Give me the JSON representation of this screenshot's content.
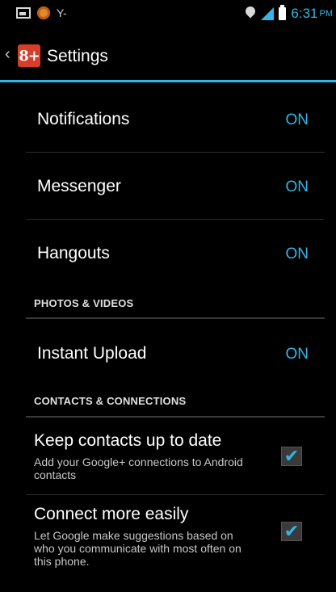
{
  "status_bar": {
    "notification_text": "Y-",
    "time": "6:31",
    "ampm": "PM",
    "accent": "#33b5e5",
    "icons": [
      "image-notification-icon",
      "coin-notification-icon",
      "location-icon",
      "signal-icon",
      "battery-icon"
    ]
  },
  "action_bar": {
    "logo_text": "8+",
    "title": "Settings"
  },
  "settings": {
    "notifications": {
      "label": "Notifications",
      "value": "ON"
    },
    "messenger": {
      "label": "Messenger",
      "value": "ON"
    },
    "hangouts": {
      "label": "Hangouts",
      "value": "ON"
    },
    "photos_header": "PHOTOS & VIDEOS",
    "instant_upload": {
      "label": "Instant Upload",
      "value": "ON"
    },
    "contacts_header": "CONTACTS & CONNECTIONS",
    "keep_contacts": {
      "title": "Keep contacts up to date",
      "subtitle": "Add your Google+ connections to Android contacts",
      "checked": true
    },
    "connect_easily": {
      "title": "Connect more easily",
      "subtitle": "Let Google make suggestions based on who you communicate with most often on this phone.",
      "checked": true
    }
  },
  "checkmark": "✔"
}
